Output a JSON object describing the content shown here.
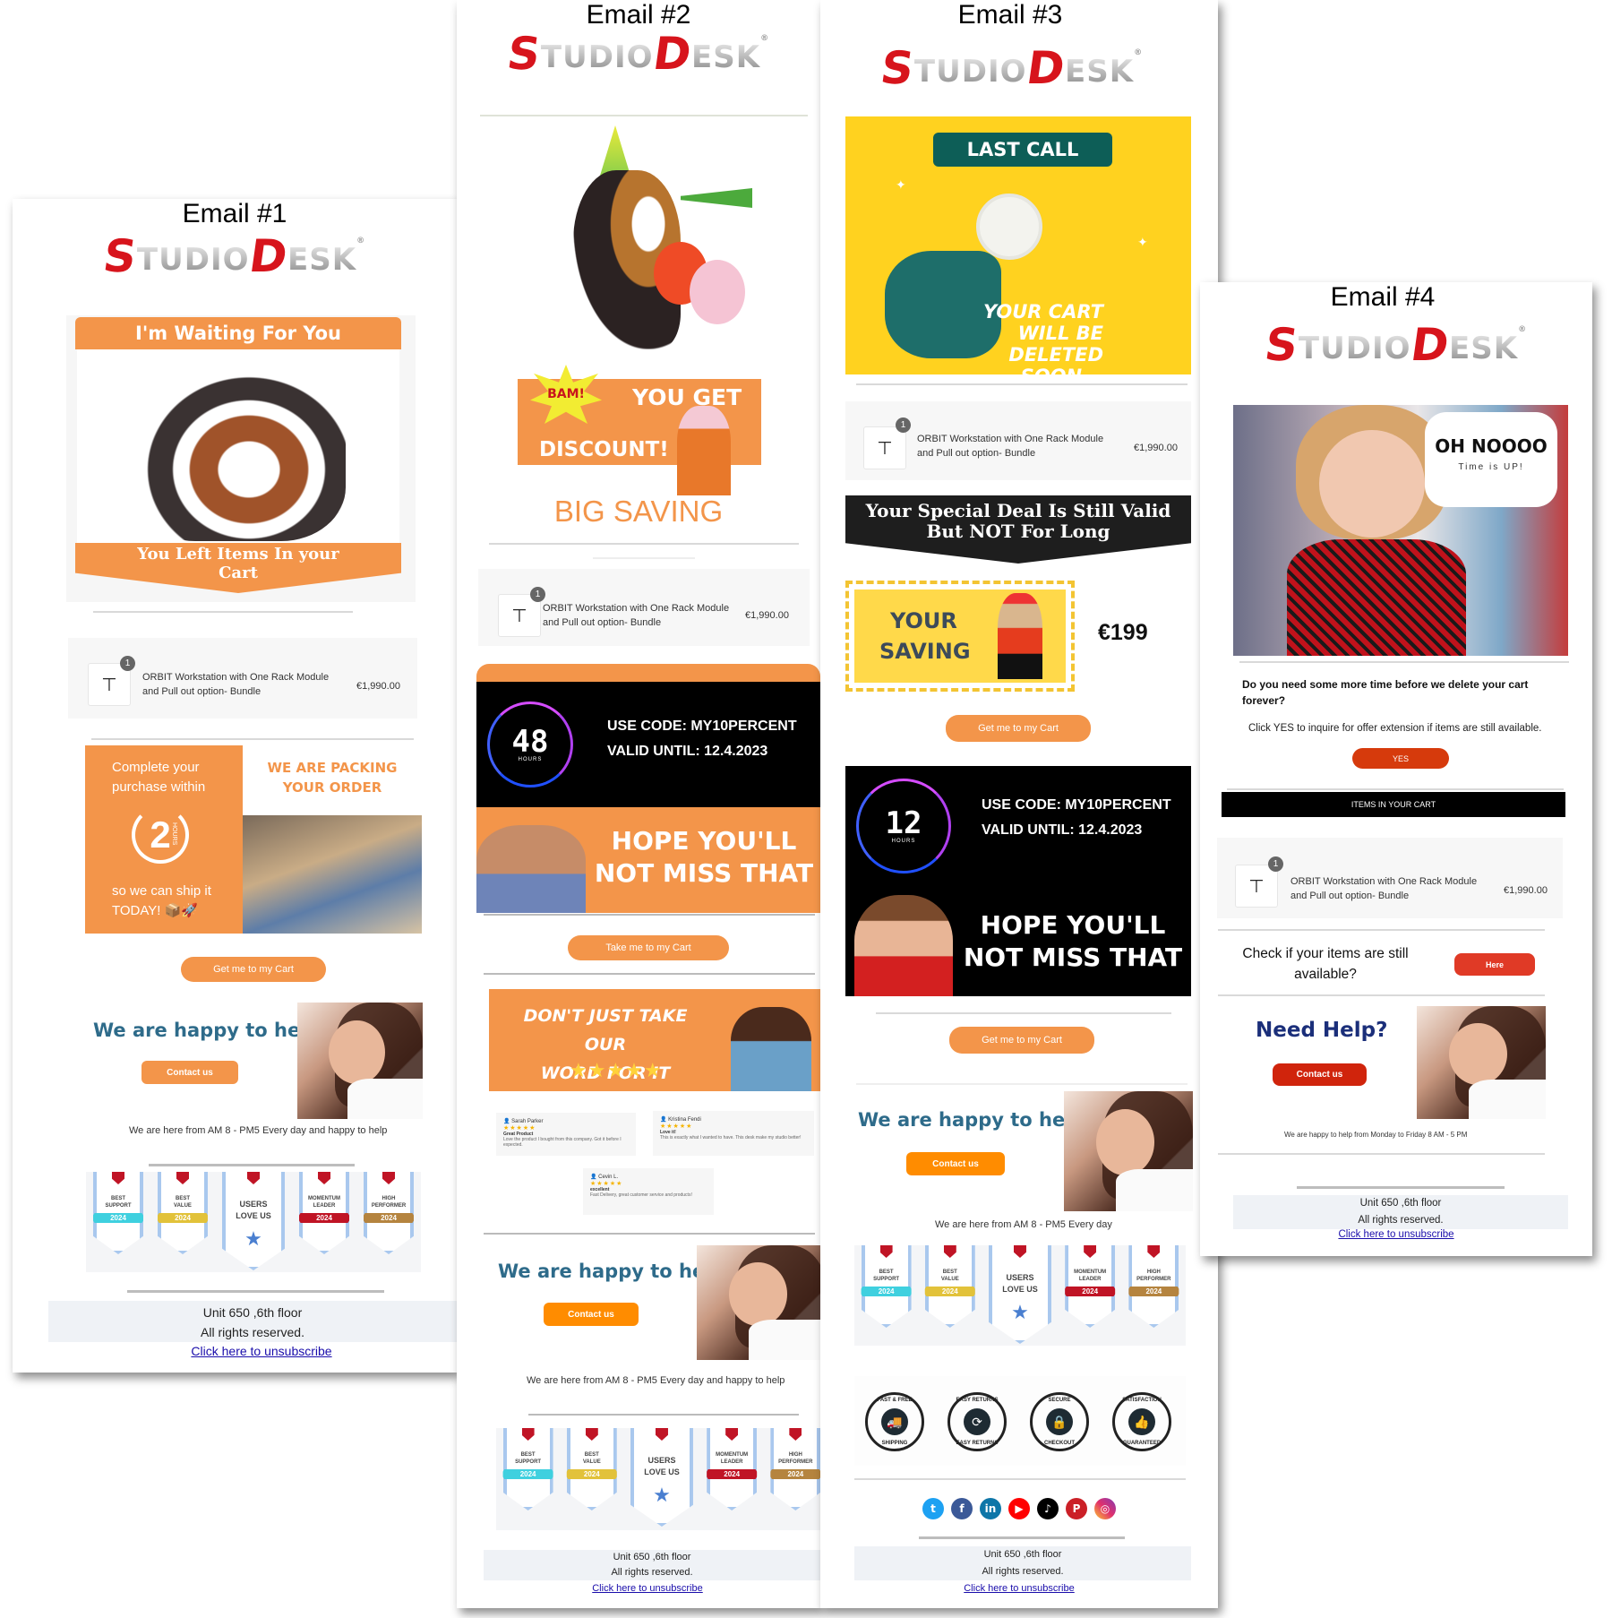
{
  "brand": {
    "logo_first": "S",
    "logo_mid": "TUDIO",
    "logo_second": "D",
    "logo_end": "ESK",
    "registered": "®"
  },
  "colors": {
    "orange": "#f3954a",
    "bright_orange": "#ff8c00",
    "red": "#d0240c",
    "teal_help": "#2e6b8a",
    "navy_help": "#1b2f7a",
    "link": "#1a0dab",
    "yellow": "#ffd21f",
    "dark_teal": "#0d5e57"
  },
  "cart_item": {
    "qty": "1",
    "name_line1": "ORBIT Workstation with One Rack Module",
    "name_line2": "and Pull out option- Bundle",
    "price": "€1,990.00"
  },
  "footer": {
    "address": "Unit 650 ,6th floor",
    "rights": "All rights reserved.",
    "unsubscribe": "Click here to unsubscribe"
  },
  "award_badges": [
    {
      "top": "BEST",
      "bottom": "SUPPORT",
      "year": "2024",
      "color": "#3fd0df"
    },
    {
      "top": "BEST",
      "bottom": "VALUE",
      "year": "2024",
      "color": "#e2c23a"
    },
    {
      "top": "USERS",
      "bottom": "LOVE US",
      "year": "",
      "color": ""
    },
    {
      "top": "MOMENTUM",
      "bottom": "LEADER",
      "year": "2024",
      "color": "#c01425"
    },
    {
      "top": "HIGH",
      "bottom": "PERFORMER",
      "year": "2024",
      "color": "#b5843f"
    }
  ],
  "email1": {
    "title": "Email #1",
    "hero_top": "I'm Waiting For You",
    "hero_bottom_line1": "You Left Items In your",
    "hero_bottom_line2": "Cart",
    "complete_line1": "Complete your",
    "complete_line2": "purchase within",
    "hours_number": "2",
    "hours_label": "HOURS",
    "ship_line1": "so we can ship it",
    "ship_line2": "TODAY! 📦🚀",
    "packing_line1": "WE ARE PACKING",
    "packing_line2": "YOUR ORDER",
    "cta": "Get me to my Cart",
    "help_title": "We are happy to help",
    "contact": "Contact us",
    "hours_text": "We are here from AM 8 - PM5 Every day and happy to help"
  },
  "email2": {
    "title": "Email #2",
    "bam": "BAM!",
    "you_get": "YOU GET",
    "discount": "DISCOUNT!",
    "big_saving": "BIG SAVING",
    "timer_number": "48",
    "timer_label": "HOURS",
    "code_line": "USE CODE: MY10PERCENT",
    "valid_line": "VALID UNTIL: 12.4.2023",
    "hope_line1": "HOPE YOU'LL",
    "hope_line2": "NOT MISS THAT",
    "cta": "Take me to my Cart",
    "reviews_title_line1": "DON'T JUST TAKE OUR",
    "reviews_title_line2": "WORD FOR IT",
    "reviews_stars": "★★★★★",
    "reviews": [
      {
        "name": "Sarah Parker",
        "rating": 5,
        "stars": "★★★★★",
        "title": "Great Product",
        "text": "Love the product I bought from this company. Got it before I expected."
      },
      {
        "name": "Kristina Fendi",
        "rating": 5,
        "stars": "★★★★★",
        "title": "Love it!",
        "text": "This is exactly what I wanted to have. This desk make my studio better!"
      },
      {
        "name": "Cevin L.",
        "rating": 5,
        "stars": "★★★★★",
        "title": "excellent",
        "text": "Fast Delivery, great customer service and products!"
      }
    ],
    "help_title": "We are happy to help",
    "contact": "Contact us",
    "hours_text": "We are here from AM 8 - PM5 Every day and happy to help"
  },
  "email3": {
    "title": "Email #3",
    "last_call": "LAST CALL",
    "cart_deleted_line1": "YOUR CART WILL BE",
    "cart_deleted_line2": "DELETED SOON...",
    "deal_line1": "Your Special Deal Is Still Valid",
    "deal_line2": "But NOT For Long",
    "saving_line1": "YOUR",
    "saving_line2": "SAVING",
    "saving_amount": "€199",
    "cta1": "Get me to my Cart",
    "timer_number": "12",
    "timer_label": "HOURS",
    "code_line": "USE CODE: MY10PERCENT",
    "valid_line": "VALID UNTIL: 12.4.2023",
    "hope_line1": "HOPE YOU'LL",
    "hope_line2": "NOT MISS THAT",
    "cta2": "Get me to my Cart",
    "help_title": "We are happy to help",
    "contact": "Contact us",
    "hours_text": "We are here from AM 8 - PM5 Every day",
    "trust_badges": [
      {
        "top": "FAST & FREE",
        "bottom": "SHIPPING",
        "icon": "truck-icon",
        "glyph": "🚚"
      },
      {
        "top": "EASY RETURNS",
        "bottom": "EASY RETURNS",
        "icon": "refresh-icon",
        "glyph": "⟳"
      },
      {
        "top": "SECURE",
        "bottom": "CHECKOUT",
        "icon": "lock-icon",
        "glyph": "🔒"
      },
      {
        "top": "SATISFACTION",
        "bottom": "GUARANTEED",
        "icon": "thumbs-up-icon",
        "glyph": "👍"
      }
    ],
    "social": [
      {
        "name": "twitter",
        "glyph": "t",
        "color": "#1da1f2"
      },
      {
        "name": "facebook",
        "glyph": "f",
        "color": "#3b5998"
      },
      {
        "name": "linkedin",
        "glyph": "in",
        "color": "#0e76a8"
      },
      {
        "name": "youtube",
        "glyph": "▶",
        "color": "#ff0000"
      },
      {
        "name": "tiktok",
        "glyph": "♪",
        "color": "#000000"
      },
      {
        "name": "pinterest",
        "glyph": "P",
        "color": "#cb2027"
      },
      {
        "name": "instagram",
        "glyph": "◎",
        "color": "#d6249f"
      }
    ]
  },
  "email4": {
    "title": "Email #4",
    "bubble_title": "OH NOOOO",
    "bubble_sub": "Time is UP!",
    "question_line1": "Do you need some more time before we delete your cart",
    "question_line2": "forever?",
    "instruction": "Click YES to inquire for offer extension if items are still available.",
    "yes": "YES",
    "items_header": "ITEMS IN YOUR CART",
    "check_line1": "Check if your items are still",
    "check_line2": "available?",
    "here": "Here",
    "help_title": "Need Help?",
    "contact": "Contact us",
    "hours_text": "We are happy to help from Monday to Friday  8 AM - 5 PM"
  }
}
